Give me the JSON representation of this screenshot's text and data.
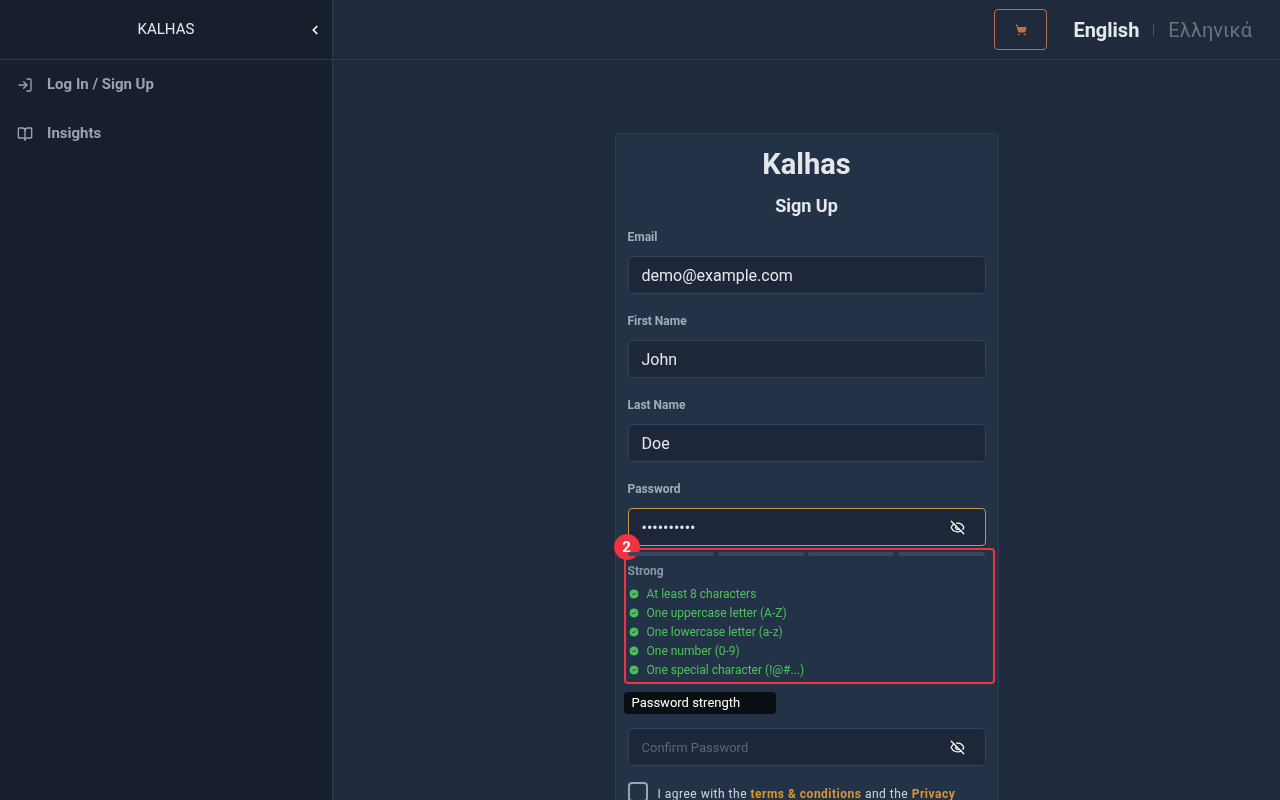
{
  "sidebar": {
    "title": "KALHAS",
    "collapsed": false,
    "items": [
      {
        "label": "Log In / Sign Up"
      },
      {
        "label": "Insights"
      }
    ]
  },
  "header": {
    "languages": [
      {
        "label": "English",
        "selected": true
      },
      {
        "label": "Ελληνικά",
        "selected": false
      }
    ]
  },
  "form": {
    "brand": "Kalhas",
    "title": "Sign Up",
    "fields": [
      {
        "label": "Email",
        "value": "demo@example.com",
        "kind": "text"
      },
      {
        "label": "First Name",
        "value": "John",
        "kind": "text"
      },
      {
        "label": "Last Name",
        "value": "Doe",
        "kind": "text"
      },
      {
        "label": "Password",
        "value": "••••••••••",
        "kind": "password",
        "focused": true
      }
    ],
    "strength": {
      "label": "Strong",
      "requirements": [
        {
          "text": "At least 8 characters",
          "met": true
        },
        {
          "text": "One uppercase letter (A-Z)",
          "met": true
        },
        {
          "text": "One lowercase letter (a-z)",
          "met": true
        },
        {
          "text": "One number (0-9)",
          "met": true
        },
        {
          "text": "One special character (!@#...)",
          "met": true
        }
      ]
    },
    "annotation": {
      "label": "2"
    },
    "tooltip": "Password strength",
    "confirm": {
      "placeholder": "Confirm Password"
    },
    "agree": {
      "checked": false,
      "text": "I agree with the **terms & conditions** and the **Privacy**"
    }
  }
}
